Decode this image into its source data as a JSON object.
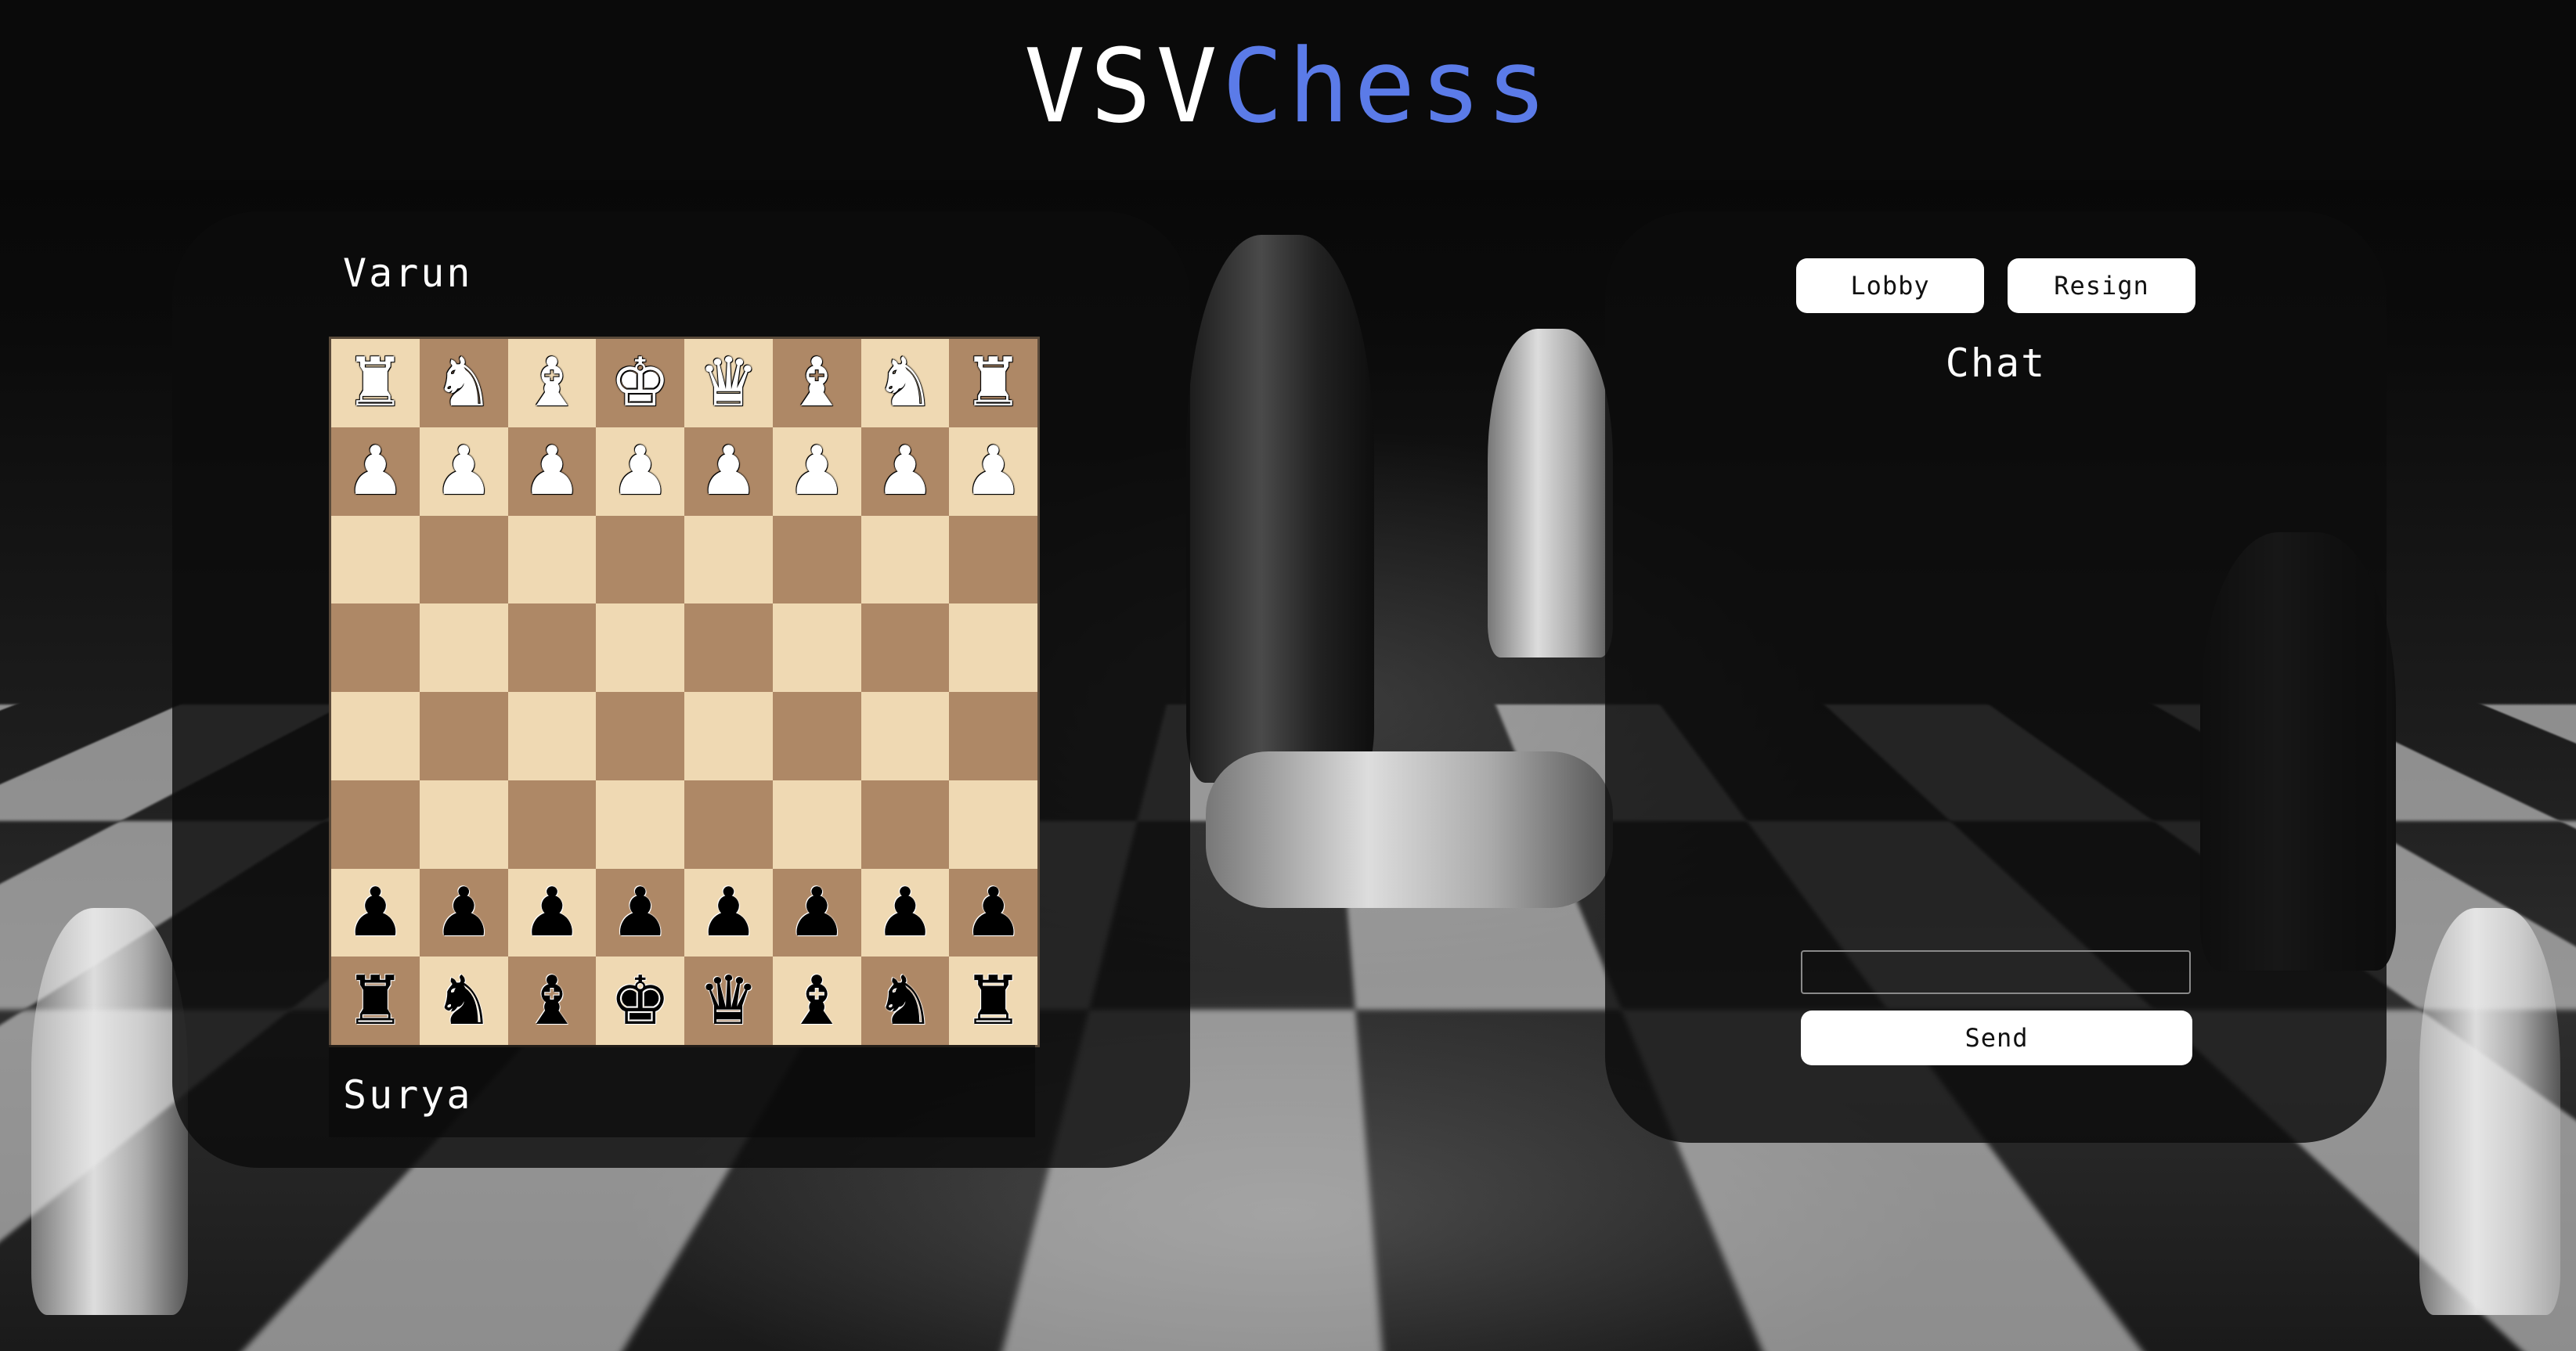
{
  "header": {
    "logo_part1": "VSV",
    "logo_part2": "Chess",
    "accent_color": "#5b7be8"
  },
  "game": {
    "top_player": "Varun",
    "bottom_player": "Surya",
    "board_colors": {
      "light": "#efd9b3",
      "dark": "#ae8866"
    },
    "board": [
      [
        "wR",
        "wN",
        "wB",
        "wK",
        "wQ",
        "wB",
        "wN",
        "wR"
      ],
      [
        "wP",
        "wP",
        "wP",
        "wP",
        "wP",
        "wP",
        "wP",
        "wP"
      ],
      [
        "",
        "",
        "",
        "",
        "",
        "",
        "",
        ""
      ],
      [
        "",
        "",
        "",
        "",
        "",
        "",
        "",
        ""
      ],
      [
        "",
        "",
        "",
        "",
        "",
        "",
        "",
        ""
      ],
      [
        "",
        "",
        "",
        "",
        "",
        "",
        "",
        ""
      ],
      [
        "bP",
        "bP",
        "bP",
        "bP",
        "bP",
        "bP",
        "bP",
        "bP"
      ],
      [
        "bR",
        "bN",
        "bB",
        "bK",
        "bQ",
        "bB",
        "bN",
        "bR"
      ]
    ]
  },
  "controls": {
    "lobby_label": "Lobby",
    "resign_label": "Resign"
  },
  "chat": {
    "title": "Chat",
    "messages": [],
    "input_value": "",
    "input_placeholder": "",
    "send_label": "Send"
  }
}
